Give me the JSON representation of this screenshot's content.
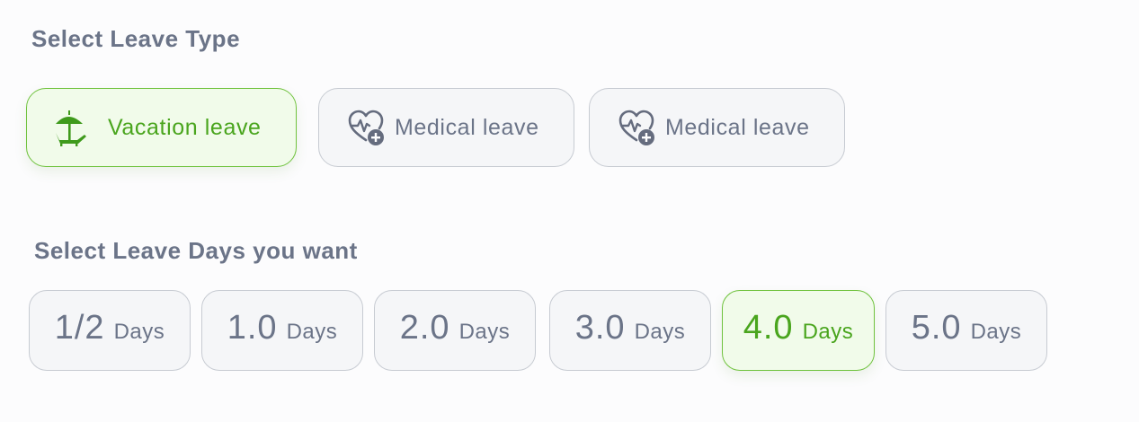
{
  "leave_type": {
    "heading": "Select Leave Type",
    "options": [
      {
        "label": "Vacation leave",
        "icon": "beach-umbrella-chair-icon",
        "selected": true
      },
      {
        "label": "Medical leave",
        "icon": "heart-pulse-plus-icon",
        "selected": false
      },
      {
        "label": "Medical leave",
        "icon": "heart-pulse-plus-icon",
        "selected": false
      }
    ]
  },
  "leave_days": {
    "heading": "Select Leave Days you want",
    "options": [
      {
        "value": "1/2",
        "unit": "Days",
        "selected": false
      },
      {
        "value": "1.0",
        "unit": "Days",
        "selected": false
      },
      {
        "value": "2.0",
        "unit": "Days",
        "selected": false
      },
      {
        "value": "3.0",
        "unit": "Days",
        "selected": false
      },
      {
        "value": "4.0",
        "unit": "Days",
        "selected": true
      },
      {
        "value": "5.0",
        "unit": "Days",
        "selected": false
      }
    ]
  },
  "colors": {
    "accent": "#4aa51e",
    "accent_bg": "#f1fbea",
    "muted_text": "#6b7488",
    "card_bg": "#f5f6f8",
    "card_border": "#c7cbd2"
  }
}
